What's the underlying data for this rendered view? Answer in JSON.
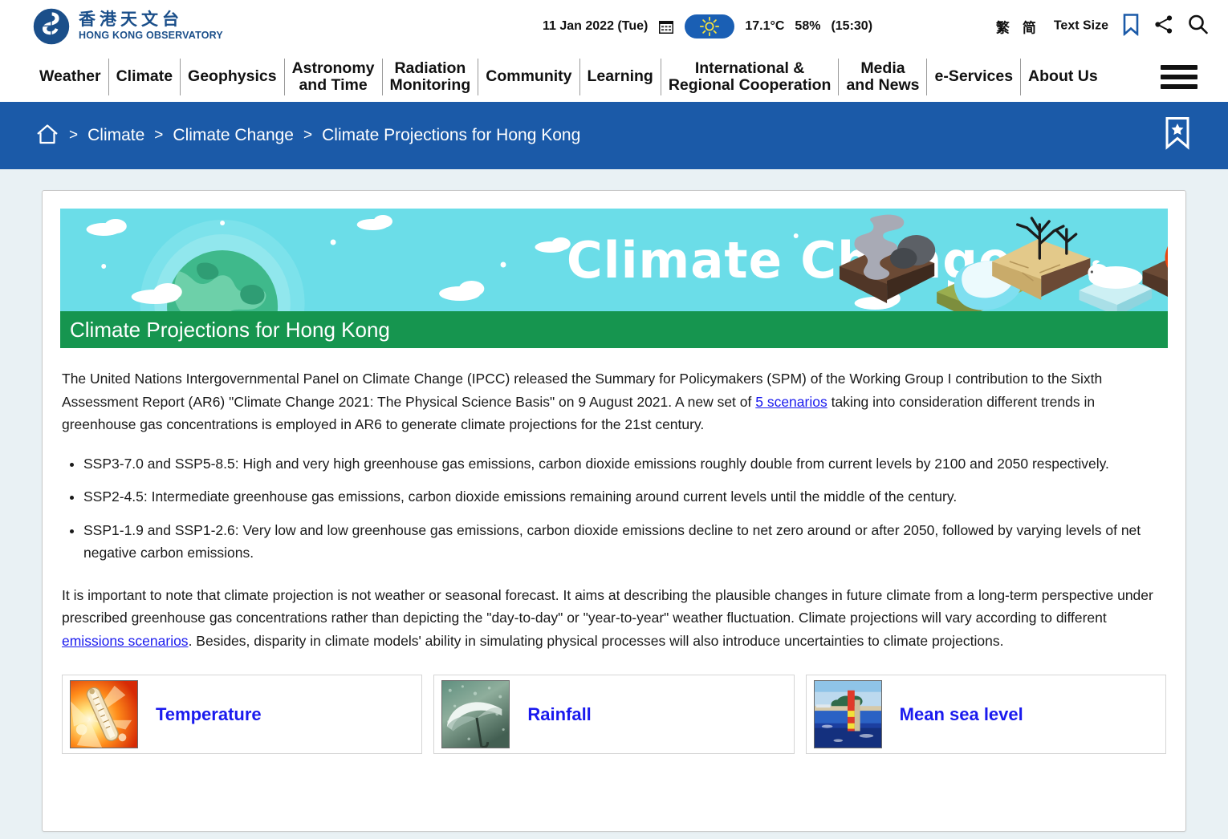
{
  "header": {
    "logo": {
      "chinese": "香港天文台",
      "english": "HONG KONG OBSERVATORY",
      "icon": "hko-swirl-logo"
    },
    "weather": {
      "date": "11 Jan 2022 (Tue)",
      "calendar_icon": "calendar-icon",
      "condition_icon": "sunny-icon",
      "temperature": "17.1°C",
      "humidity": "58%",
      "time": "(15:30)"
    },
    "tools": {
      "lang_traditional": "繁",
      "lang_simplified": "简",
      "text_size": "Text Size",
      "bookmark_icon": "bookmark-icon",
      "share_icon": "share-icon",
      "search_icon": "search-icon"
    }
  },
  "nav": {
    "items": [
      "Weather",
      "Climate",
      "Geophysics",
      "Astronomy\nand Time",
      "Radiation\nMonitoring",
      "Community",
      "Learning",
      "International &\nRegional Cooperation",
      "Media\nand News",
      "e-Services",
      "About Us"
    ],
    "menu_icon": "hamburger-menu-icon"
  },
  "breadcrumb": {
    "home_icon": "home-icon",
    "separator": ">",
    "items": [
      "Climate",
      "Climate Change",
      "Climate Projections for Hong Kong"
    ],
    "bookmark_icon": "bookmark-star-icon"
  },
  "banner": {
    "title_text": "Climate Change",
    "section_title": "Climate Projections for Hong Kong",
    "colors": {
      "sky": "#6bdde8",
      "green_bar": "#16954f",
      "globe_green": "#2aa06a"
    }
  },
  "content": {
    "intro": {
      "part1": "The United Nations Intergovernmental Panel on Climate Change (IPCC) released the Summary for Policymakers (SPM) of the Working Group I contribution to the Sixth Assessment Report (AR6) \"Climate Change 2021: The Physical Science Basis\" on 9 August 2021. A new set of ",
      "link": "5 scenarios",
      "part2": " taking into consideration different trends in greenhouse gas concentrations is employed in AR6 to generate climate projections for the 21st century."
    },
    "bullets": [
      "SSP3-7.0 and SSP5-8.5: High and very high greenhouse gas emissions, carbon dioxide emissions roughly double from current levels by 2100 and 2050 respectively.",
      "SSP2-4.5: Intermediate greenhouse gas emissions, carbon dioxide emissions remaining around current levels until the middle of the century.",
      "SSP1-1.9 and SSP1-2.6: Very low and low greenhouse gas emissions, carbon dioxide emissions decline to net zero around or after 2050, followed by varying levels of net negative carbon emissions."
    ],
    "note": {
      "part1": "It is important to note that climate projection is not weather or seasonal forecast. It aims at describing the plausible changes in future climate from a long-term perspective under prescribed greenhouse gas concentrations rather than depicting the \"day-to-day\" or \"year-to-year\" weather fluctuation. Climate projections will vary according to different ",
      "link": "emissions scenarios",
      "part2": ". Besides, disparity in climate models' ability in simulating physical processes will also introduce uncertainties to climate projections."
    },
    "tiles": [
      {
        "label": "Temperature",
        "thumb": "thermometer-sun-thumbnail"
      },
      {
        "label": "Rainfall",
        "thumb": "umbrella-rain-thumbnail"
      },
      {
        "label": "Mean sea level",
        "thumb": "tide-gauge-sea-thumbnail"
      }
    ]
  }
}
